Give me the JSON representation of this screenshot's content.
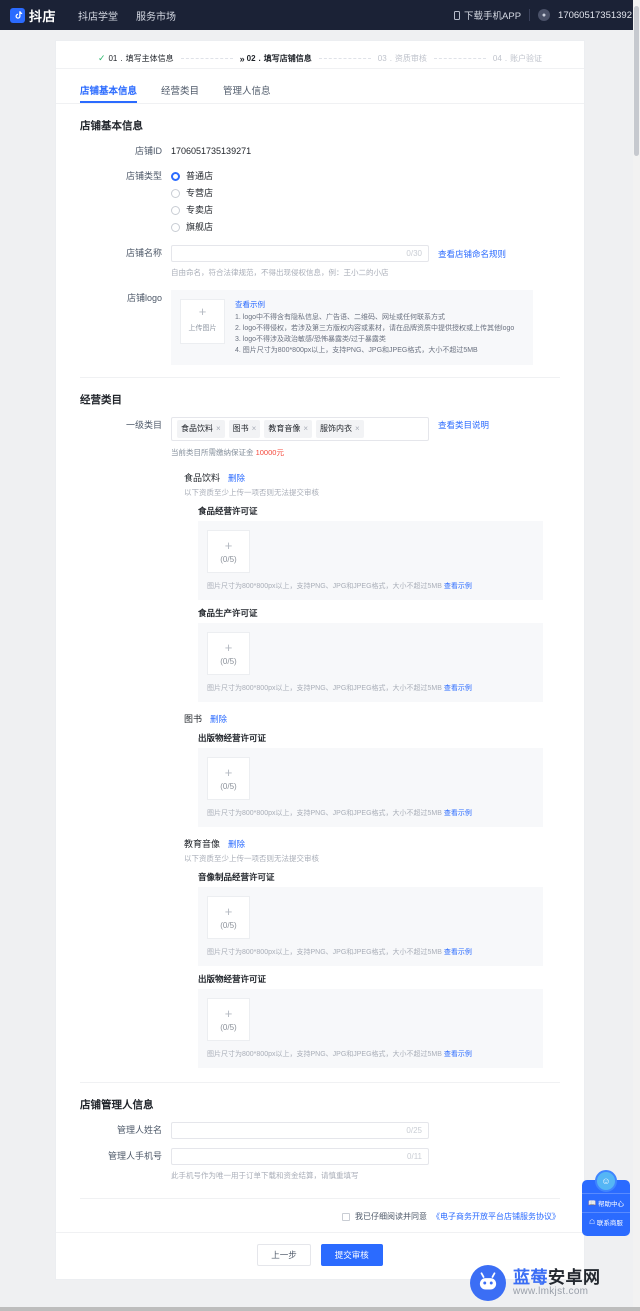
{
  "topbar": {
    "brand": "抖店",
    "nav": [
      "抖店学堂",
      "服务市场"
    ],
    "download_app": "下载手机APP",
    "username": "17060517351392"
  },
  "steps": [
    {
      "index": "01",
      "label": "填写主体信息",
      "state": "done"
    },
    {
      "index": "02",
      "label": "填写店铺信息",
      "state": "active"
    },
    {
      "index": "03",
      "label": "资质审核",
      "state": "todo"
    },
    {
      "index": "04",
      "label": "账户验证",
      "state": "todo"
    }
  ],
  "tabs": [
    {
      "label": "店铺基本信息",
      "selected": true
    },
    {
      "label": "经营类目",
      "selected": false
    },
    {
      "label": "管理人信息",
      "selected": false
    }
  ],
  "basic": {
    "section_title": "店铺基本信息",
    "shop_id_label": "店铺ID",
    "shop_id_value": "1706051735139271",
    "shop_type_label": "店铺类型",
    "shop_types": [
      {
        "label": "普通店",
        "checked": true
      },
      {
        "label": "专营店",
        "checked": false
      },
      {
        "label": "专卖店",
        "checked": false
      },
      {
        "label": "旗舰店",
        "checked": false
      }
    ],
    "shop_name_label": "店铺名称",
    "shop_name_value": "",
    "shop_name_counter": "0/30",
    "shop_name_rule_link": "查看店铺命名规则",
    "shop_name_hint": "自由命名，符合法律规范，不得出现侵权信息，例：王小二的小店",
    "logo_label": "店铺logo",
    "logo_upload_plus": "+",
    "logo_upload_caption": "上传图片",
    "logo_example_link": "查看示例",
    "logo_rules": [
      "1. logo中不得含有隐私信息、广告语、二维码、网址或任何联系方式",
      "2. logo不得侵权，若涉及第三方版权内容或素材，请在品牌资质中提供授权或上传其他logo",
      "3. logo不得涉及政治敏感/恐怖暴露类/过于暴露类",
      "4. 图片尺寸为800*800px以上，支持PNG、JPG和JPEG格式，大小不超过5MB"
    ]
  },
  "category": {
    "section_title": "经营类目",
    "primary_label": "一级类目",
    "tags": [
      "食品饮料",
      "图书",
      "教育音像",
      "服饰内衣"
    ],
    "explain_link": "查看类目说明",
    "deposit_prefix": "当前类目所需缴纳保证金 ",
    "deposit_amount": "10000元",
    "delete_label": "删除",
    "multi_note": "以下资质至少上传一项否则无法提交审核",
    "upload_plus": "+",
    "upload_counter": "(0/5)",
    "upload_hint": "图片尺寸为800*800px以上，支持PNG、JPG和JPEG格式，大小不超过5MB",
    "example_link": "查看示例",
    "groups": [
      {
        "name": "食品饮料",
        "note": "以下资质至少上传一项否则无法提交审核",
        "quals": [
          "食品经营许可证",
          "食品生产许可证"
        ]
      },
      {
        "name": "图书",
        "note": "",
        "quals": [
          "出版物经营许可证"
        ]
      },
      {
        "name": "教育音像",
        "note": "以下资质至少上传一项否则无法提交审核",
        "quals": [
          "音像制品经营许可证",
          "出版物经营许可证"
        ]
      }
    ]
  },
  "manager": {
    "section_title": "店铺管理人信息",
    "name_label": "管理人姓名",
    "name_value": "",
    "name_counter": "0/25",
    "phone_label": "管理人手机号",
    "phone_value": "",
    "phone_counter": "0/11",
    "phone_hint": "此手机号作为唯一用于订单下载和资金结算，请慎重填写"
  },
  "footer": {
    "agree_text": "我已仔细阅读并同意",
    "agreement_link": "《电子商务开放平台店铺服务协议》",
    "prev_button": "上一步",
    "submit_button": "提交审核"
  },
  "help_widget": {
    "items": [
      "帮助中心",
      "联系商服"
    ]
  },
  "watermark": {
    "name_blue": "蓝莓",
    "name_dark": "安卓网",
    "url": "www.lmkjst.com"
  }
}
